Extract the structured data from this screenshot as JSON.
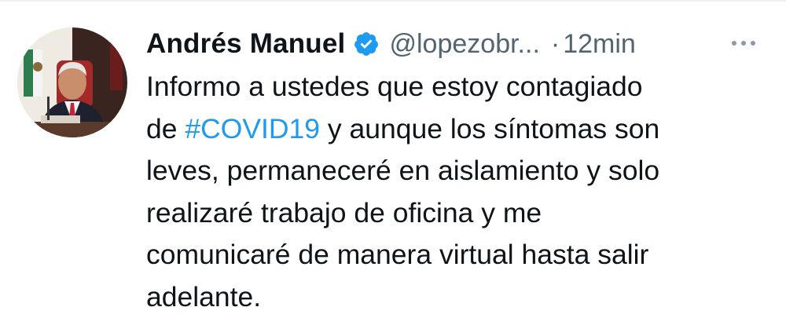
{
  "tweet": {
    "author_name": "Andrés Manuel",
    "handle": "@lopezobr...",
    "separator": "·",
    "time": "12min",
    "verified_icon": "verified-badge-icon",
    "more_icon": "more-options-icon",
    "accent_color": "#1d9bf0",
    "lines": {
      "line1": "Informo a ustedes que estoy contagiado",
      "line2_prefix": "de ",
      "hashtag": "#COVID19",
      "line2_suffix": " y aunque los síntomas son",
      "line3": "leves, permaneceré en aislamiento y solo",
      "line4": "realizaré trabajo de oficina y me",
      "line5": "comunicaré de manera virtual hasta salir",
      "line6": "adelante."
    }
  }
}
